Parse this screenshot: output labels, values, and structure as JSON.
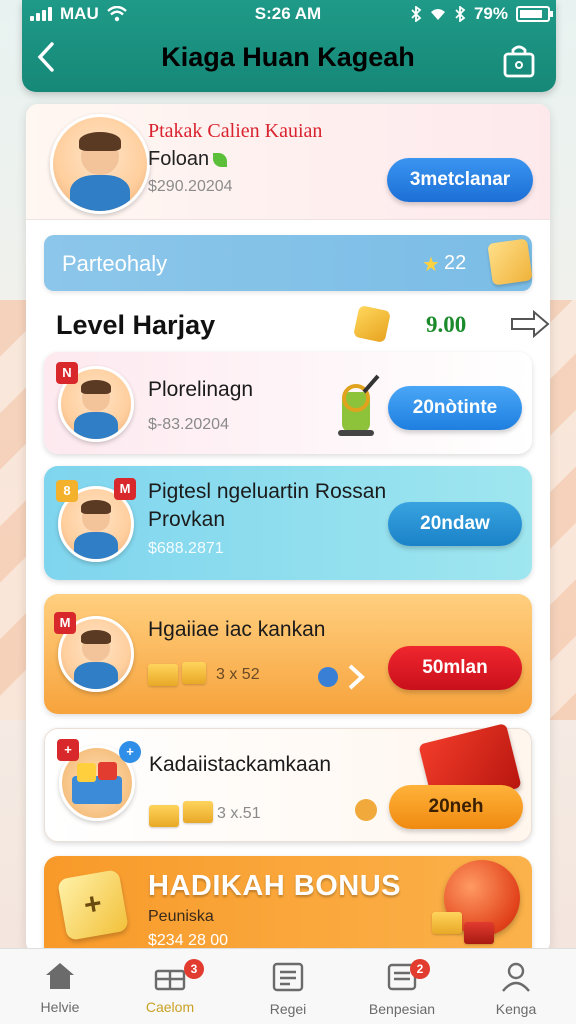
{
  "status_bar": {
    "carrier": "MAU",
    "time": "S:26 AM",
    "battery": "79%"
  },
  "header": {
    "title": "Kiaga Huan Kageah",
    "back_icon": "chevron-left-icon",
    "bag_icon": "shopping-bag-icon"
  },
  "profile": {
    "name": "Ptakak Calien Kauian",
    "subtitle": "Foloan",
    "amount": "$290.20204",
    "button": "3metclanar"
  },
  "progress": {
    "label": "Parteohaly",
    "stars": "22"
  },
  "level": {
    "label": "Level Harjay",
    "value": "9.00"
  },
  "cards": [
    {
      "title": "Plorelinagn",
      "meta": "$-83.20204",
      "button": "20nòtinte",
      "button_color": "#2f8fe8"
    },
    {
      "title": "Pigtesl ngeluartin Rossan",
      "title2": "Provkan",
      "meta": "$688.2871",
      "button": "20ndaw",
      "button_color": "#2a8fd8"
    },
    {
      "title": "Hgaiiae iac kankan",
      "meta": "3 x 52",
      "button": "50mlan",
      "button_color": "#e0162a"
    },
    {
      "title": "Kadaiistackamkaan",
      "meta": "3 x.51",
      "button": "20neh",
      "button_color": "#f7a21c"
    }
  ],
  "bonus": {
    "title": "HADIKAH BONUS",
    "subtitle": "Peuniska",
    "amount": "$234 28 00"
  },
  "tabs": [
    {
      "label": "Helvie",
      "icon": "home-icon"
    },
    {
      "label": "Caelom",
      "icon": "gift-icon",
      "badge": "3"
    },
    {
      "label": "Regei",
      "icon": "list-icon"
    },
    {
      "label": "Benpesian",
      "icon": "document-icon",
      "badge": "2"
    },
    {
      "label": "Kenga",
      "icon": "profile-icon"
    }
  ]
}
